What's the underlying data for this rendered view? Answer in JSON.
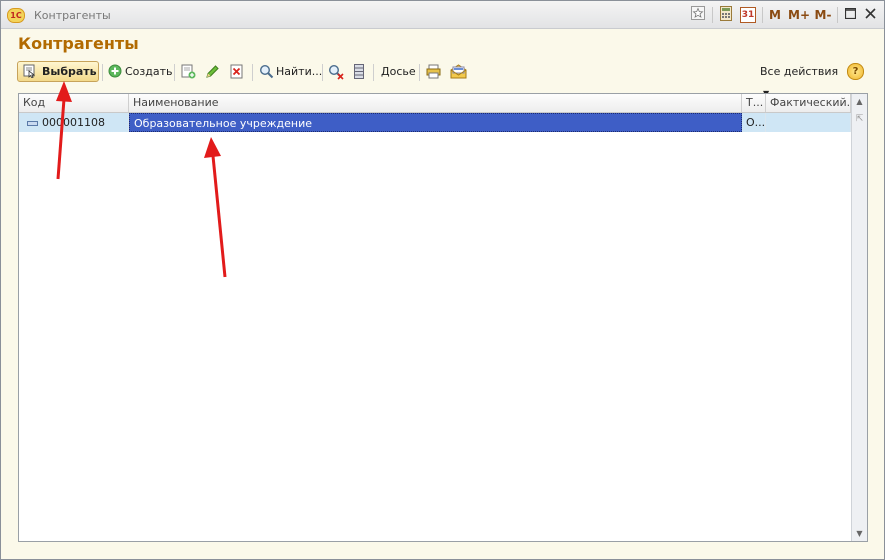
{
  "window": {
    "title": "Контрагенты",
    "logo_text": "1С",
    "titlebar_buttons": [
      "М",
      "М+",
      "М-"
    ],
    "calendar_day": "31"
  },
  "form": {
    "title": "Контрагенты"
  },
  "toolbar": {
    "select_label": "Выбрать",
    "create_label": "Создать",
    "find_label": "Найти...",
    "dossier_label": "Досье",
    "all_actions_label": "Все действия",
    "help_label": "?"
  },
  "table": {
    "columns": [
      "Код",
      "Наименование",
      "Т...",
      "Фактический..."
    ],
    "rows": [
      {
        "code": "000001108",
        "name": "Образовательное учреждение",
        "type": "О...",
        "actual": ""
      }
    ]
  },
  "colors": {
    "accent_title": "#b26a00",
    "selection": "#3e5ec6",
    "row_highlight": "#cfe6f5",
    "annotation_arrow": "#e21b1b"
  }
}
